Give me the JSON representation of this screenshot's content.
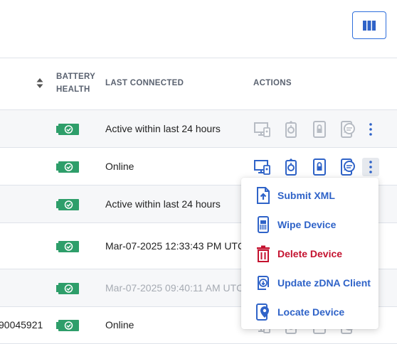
{
  "toolbar": {
    "columns_icon": "columns-icon"
  },
  "table": {
    "headers": {
      "battery": [
        "BATTERY",
        "HEALTH"
      ],
      "last_connected": "LAST CONNECTED",
      "actions": "ACTIONS"
    },
    "rows": [
      {
        "serial": "",
        "last_connected": "Active within last 24 hours",
        "muted": false,
        "actions_enabled": false
      },
      {
        "serial": "",
        "last_connected": "Online",
        "muted": false,
        "actions_enabled": true
      },
      {
        "serial": "",
        "last_connected": "Active within last 24 hours",
        "muted": false,
        "actions_enabled": false
      },
      {
        "serial": "",
        "last_connected": "Mar-07-2025 12:33:43 PM UTC",
        "muted": false,
        "actions_enabled": false
      },
      {
        "serial": "",
        "last_connected": "Mar-07-2025 09:40:11 AM UTC",
        "muted": true,
        "actions_enabled": false
      },
      {
        "serial": "90045921",
        "last_connected": "Online",
        "muted": false,
        "actions_enabled": false
      }
    ]
  },
  "menu": {
    "items": [
      {
        "label": "Submit XML",
        "icon": "submit-xml-icon",
        "danger": false
      },
      {
        "label": "Wipe Device",
        "icon": "wipe-device-icon",
        "danger": false
      },
      {
        "label": "Delete Device",
        "icon": "trash-icon",
        "danger": true
      },
      {
        "label": "Update zDNA Client",
        "icon": "update-client-icon",
        "danger": false
      },
      {
        "label": "Locate Device",
        "icon": "locate-device-icon",
        "danger": false
      }
    ]
  },
  "colors": {
    "accent": "#2f63c8",
    "danger": "#c4122f",
    "battery": "#2e9e6a",
    "disabled_icon": "#b7bcc4"
  }
}
